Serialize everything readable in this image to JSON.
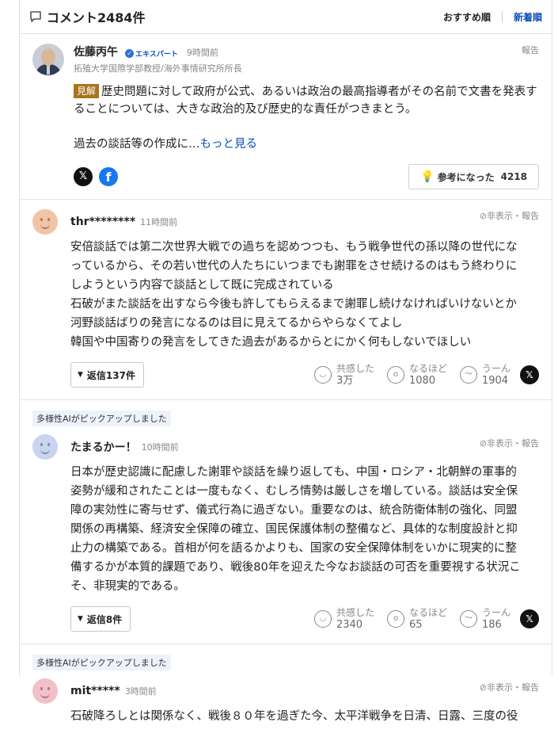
{
  "header": {
    "title": "コメント2484件",
    "sort_recommended": "おすすめ順",
    "sort_newest": "新着順"
  },
  "expert": {
    "name": "佐藤丙午",
    "badge": "エキスパート",
    "time": "9時間前",
    "affiliation": "拓殖大学国際学部教授/海外事情研究所所長",
    "report": "報告",
    "tag": "見解",
    "text": "歴史問題に対して政府が公式、あるいは政治の最高指導者がその名前で文書を発表することについては、大きな政治的及び歴史的な責任がつきまとう。",
    "text2": "過去の談話等の作成に…",
    "more": "もっと見る",
    "x_label": "𝕏",
    "fb_label": "f",
    "helpful_label": "参考になった",
    "helpful_count": "4218"
  },
  "comments": [
    {
      "pick": "",
      "user": "thr********",
      "time": "11時間前",
      "actions": "非表示・報告",
      "avatar_color": "#f3c3a5",
      "lines": [
        "安倍談話では第二次世界大戦での過ちを認めつつも、もう戦争世代の孫以降の世代にな",
        "っているから、その若い世代の人たちにいつまでも謝罪をさせ続けるのはもう終わりに",
        "しようという内容で談話として既に完成されている",
        "石破がまた談話を出すなら今後も許してもらえるまで謝罪し続けなければいけないとか",
        "河野談話ばりの発言になるのは目に見えてるからやらなくてよし",
        "韓国や中国寄りの発言をしてきた過去があるからとにかく何もしないでほしい"
      ],
      "replies": "返信137件",
      "empathy_label": "共感した",
      "empathy": "3万",
      "naruhodo_label": "なるほど",
      "naruhodo": "1080",
      "uun_label": "うーん",
      "uun": "1904"
    },
    {
      "pick": "多様性AIがピックアップしました",
      "user": "たまるかー！",
      "time": "10時間前",
      "actions": "非表示・報告",
      "avatar_color": "#c9d4f1",
      "lines": [
        "日本が歴史認識に配慮した謝罪や談話を繰り返しても、中国・ロシア・北朝鮮の軍事的",
        "姿勢が緩和されたことは一度もなく、むしろ情勢は厳しさを増している。談話は安全保",
        "障の実効性に寄与せず、儀式行為に過ぎない。重要なのは、統合防衛体制の強化、同盟",
        "関係の再構築、経済安全保障の確立、国民保護体制の整備など、具体的な制度設計と抑",
        "止力の構築である。首相が何を語るかよりも、国家の安全保障体制をいかに現実的に整",
        "備するかが本質的課題であり、戦後80年を迎えた今なお談話の可否を重要視する状況こ",
        "そ、非現実的である。"
      ],
      "replies": "返信8件",
      "empathy_label": "共感した",
      "empathy": "2340",
      "naruhodo_label": "なるほど",
      "naruhodo": "65",
      "uun_label": "うーん",
      "uun": "186"
    },
    {
      "pick": "多様性AIがピックアップしました",
      "user": "mit*****",
      "time": "3時間前",
      "actions": "非表示・報告",
      "avatar_color": "#f2c0c6",
      "lines": [
        "石破降ろしとは関係なく、戦後８０年を過ぎた今、太平洋戦争を日清、日露、三度の役"
      ]
    }
  ]
}
